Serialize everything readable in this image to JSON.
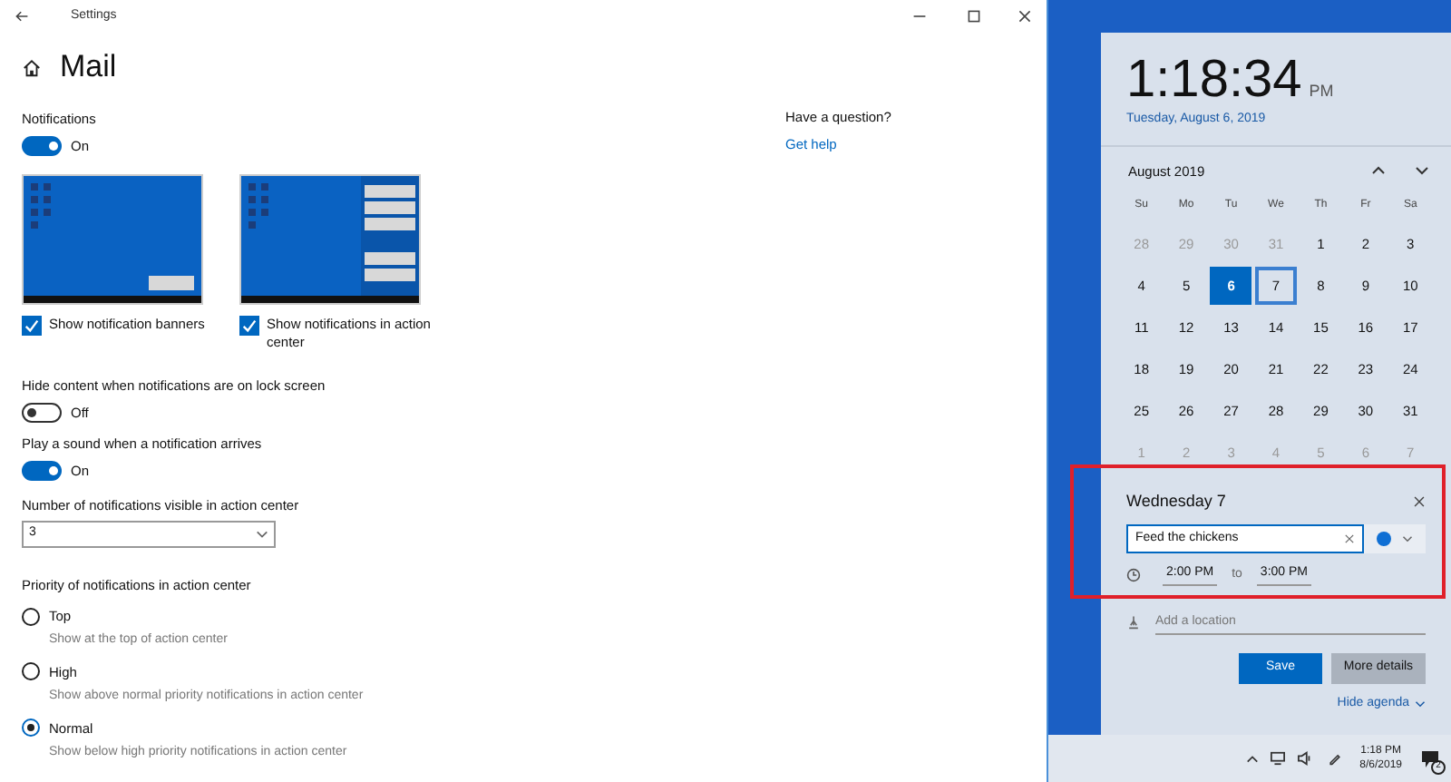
{
  "window": {
    "title": "Settings"
  },
  "page": {
    "title": "Mail"
  },
  "help": {
    "question": "Have a question?",
    "link": "Get help"
  },
  "notifications": {
    "label": "Notifications",
    "on": true,
    "state": "On"
  },
  "previews": [
    {
      "kind": "banner",
      "label": "Show notification banners",
      "checked": true
    },
    {
      "kind": "action_center",
      "label": "Show notifications in action center",
      "checked": true
    }
  ],
  "toggles": [
    {
      "label": "Hide content when notifications are on lock screen",
      "on": false,
      "state": "Off"
    },
    {
      "label": "Play a sound when a notification arrives",
      "on": true,
      "state": "On"
    }
  ],
  "count": {
    "label": "Number of notifications visible in action center",
    "value": "3"
  },
  "priority": {
    "label": "Priority of notifications in action center",
    "options": [
      {
        "label": "Top",
        "hint": "Show at the top of action center",
        "selected": false
      },
      {
        "label": "High",
        "hint": "Show above normal priority notifications in action center",
        "selected": false
      },
      {
        "label": "Normal",
        "hint": "Show below high priority notifications in action center",
        "selected": true
      }
    ]
  },
  "clock": {
    "time": "1:18:34",
    "ampm": "PM",
    "date": "Tuesday, August 6, 2019"
  },
  "calendar": {
    "month": "August 2019",
    "weekdays": [
      "Su",
      "Mo",
      "Tu",
      "We",
      "Th",
      "Fr",
      "Sa"
    ],
    "days": [
      {
        "label": "28",
        "in_month": false,
        "today": false,
        "selected": false
      },
      {
        "label": "29",
        "in_month": false,
        "today": false,
        "selected": false
      },
      {
        "label": "30",
        "in_month": false,
        "today": false,
        "selected": false
      },
      {
        "label": "31",
        "in_month": false,
        "today": false,
        "selected": false
      },
      {
        "label": "1",
        "in_month": true,
        "today": false,
        "selected": false
      },
      {
        "label": "2",
        "in_month": true,
        "today": false,
        "selected": false
      },
      {
        "label": "3",
        "in_month": true,
        "today": false,
        "selected": false
      },
      {
        "label": "4",
        "in_month": true,
        "today": false,
        "selected": false
      },
      {
        "label": "5",
        "in_month": true,
        "today": false,
        "selected": false
      },
      {
        "label": "6",
        "in_month": true,
        "today": true,
        "selected": false
      },
      {
        "label": "7",
        "in_month": true,
        "today": false,
        "selected": true
      },
      {
        "label": "8",
        "in_month": true,
        "today": false,
        "selected": false
      },
      {
        "label": "9",
        "in_month": true,
        "today": false,
        "selected": false
      },
      {
        "label": "10",
        "in_month": true,
        "today": false,
        "selected": false
      },
      {
        "label": "11",
        "in_month": true,
        "today": false,
        "selected": false
      },
      {
        "label": "12",
        "in_month": true,
        "today": false,
        "selected": false
      },
      {
        "label": "13",
        "in_month": true,
        "today": false,
        "selected": false
      },
      {
        "label": "14",
        "in_month": true,
        "today": false,
        "selected": false
      },
      {
        "label": "15",
        "in_month": true,
        "today": false,
        "selected": false
      },
      {
        "label": "16",
        "in_month": true,
        "today": false,
        "selected": false
      },
      {
        "label": "17",
        "in_month": true,
        "today": false,
        "selected": false
      },
      {
        "label": "18",
        "in_month": true,
        "today": false,
        "selected": false
      },
      {
        "label": "19",
        "in_month": true,
        "today": false,
        "selected": false
      },
      {
        "label": "20",
        "in_month": true,
        "today": false,
        "selected": false
      },
      {
        "label": "21",
        "in_month": true,
        "today": false,
        "selected": false
      },
      {
        "label": "22",
        "in_month": true,
        "today": false,
        "selected": false
      },
      {
        "label": "23",
        "in_month": true,
        "today": false,
        "selected": false
      },
      {
        "label": "24",
        "in_month": true,
        "today": false,
        "selected": false
      },
      {
        "label": "25",
        "in_month": true,
        "today": false,
        "selected": false
      },
      {
        "label": "26",
        "in_month": true,
        "today": false,
        "selected": false
      },
      {
        "label": "27",
        "in_month": true,
        "today": false,
        "selected": false
      },
      {
        "label": "28",
        "in_month": true,
        "today": false,
        "selected": false
      },
      {
        "label": "29",
        "in_month": true,
        "today": false,
        "selected": false
      },
      {
        "label": "30",
        "in_month": true,
        "today": false,
        "selected": false
      },
      {
        "label": "31",
        "in_month": true,
        "today": false,
        "selected": false
      },
      {
        "label": "1",
        "in_month": false,
        "today": false,
        "selected": false
      },
      {
        "label": "2",
        "in_month": false,
        "today": false,
        "selected": false
      },
      {
        "label": "3",
        "in_month": false,
        "today": false,
        "selected": false
      },
      {
        "label": "4",
        "in_month": false,
        "today": false,
        "selected": false
      },
      {
        "label": "5",
        "in_month": false,
        "today": false,
        "selected": false
      },
      {
        "label": "6",
        "in_month": false,
        "today": false,
        "selected": false
      },
      {
        "label": "7",
        "in_month": false,
        "today": false,
        "selected": false
      }
    ]
  },
  "event": {
    "day": "Wednesday 7",
    "title": "Feed the chickens",
    "start": "2:00 PM",
    "to": "to",
    "end": "3:00 PM",
    "location_placeholder": "Add a location",
    "save": "Save",
    "more": "More details",
    "hide_agenda": "Hide agenda"
  },
  "taskbar": {
    "time": "1:18 PM",
    "date": "8/6/2019",
    "notification_count": "2"
  }
}
